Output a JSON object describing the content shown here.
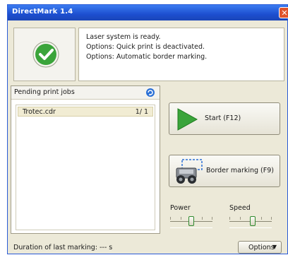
{
  "window": {
    "title": "DirectMark 1.4"
  },
  "status": {
    "lines": [
      "Laser system is ready.",
      "Options: Quick print is deactivated.",
      "Options: Automatic border marking."
    ]
  },
  "jobs": {
    "header": "Pending print jobs",
    "items": [
      {
        "name": "Trotec.cdr",
        "count": "1/ 1"
      }
    ]
  },
  "actions": {
    "start_label": "Start (F12)",
    "border_label": "Border marking (F9)"
  },
  "sliders": {
    "power_label": "Power",
    "speed_label": "Speed",
    "power_level": 0.5,
    "speed_level": 0.55
  },
  "footer": {
    "duration_label": "Duration of last marking: --- s",
    "options_label": "Options"
  },
  "colors": {
    "accent_green": "#3aa43a",
    "titlebar_blue": "#1d4fd0",
    "close_red": "#e0542c"
  }
}
